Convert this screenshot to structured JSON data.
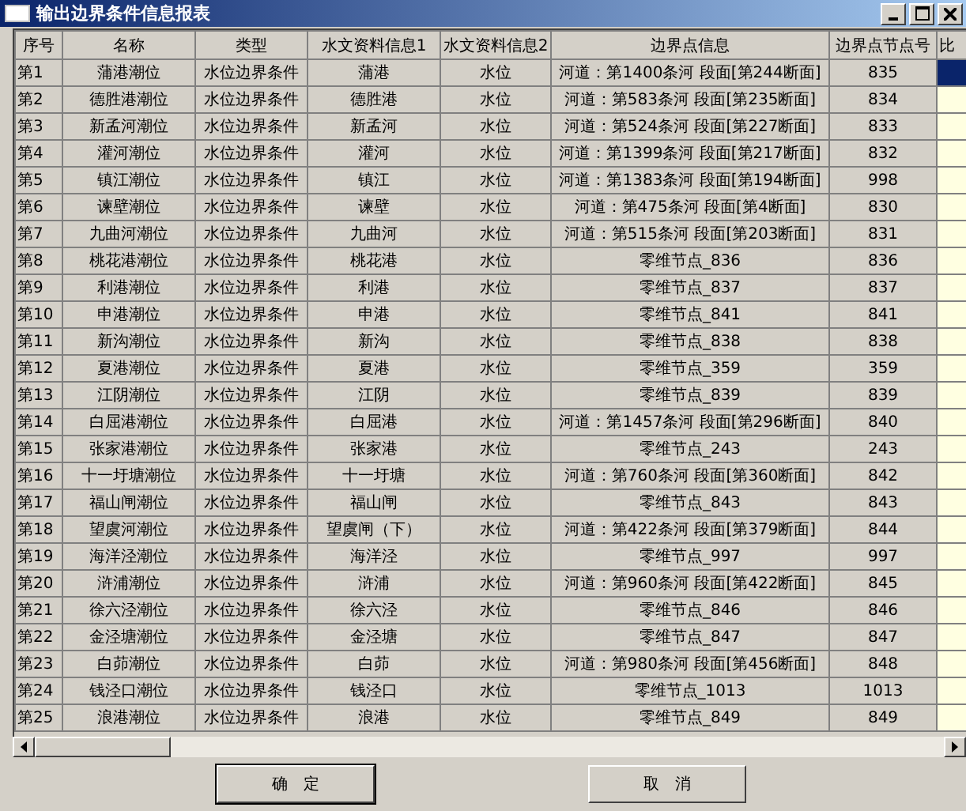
{
  "window": {
    "title": "输出边界条件信息报表"
  },
  "table": {
    "columns": [
      "序号",
      "名称",
      "类型",
      "水文资料信息1",
      "水文资料信息2",
      "边界点信息",
      "边界点节点号",
      "比"
    ],
    "rows": [
      {
        "cells": [
          "第1",
          "蒲港潮位",
          "水位边界条件",
          "蒲港",
          "水位",
          "河道：第1400条河 段面[第244断面]",
          "835"
        ],
        "selected": true
      },
      {
        "cells": [
          "第2",
          "德胜港潮位",
          "水位边界条件",
          "德胜港",
          "水位",
          "河道：第583条河 段面[第235断面]",
          "834"
        ],
        "selected": false
      },
      {
        "cells": [
          "第3",
          "新孟河潮位",
          "水位边界条件",
          "新孟河",
          "水位",
          "河道：第524条河 段面[第227断面]",
          "833"
        ],
        "selected": false
      },
      {
        "cells": [
          "第4",
          "灌河潮位",
          "水位边界条件",
          "灌河",
          "水位",
          "河道：第1399条河 段面[第217断面]",
          "832"
        ],
        "selected": false
      },
      {
        "cells": [
          "第5",
          "镇江潮位",
          "水位边界条件",
          "镇江",
          "水位",
          "河道：第1383条河 段面[第194断面]",
          "998"
        ],
        "selected": false
      },
      {
        "cells": [
          "第6",
          "谏壁潮位",
          "水位边界条件",
          "谏壁",
          "水位",
          "河道：第475条河 段面[第4断面]",
          "830"
        ],
        "selected": false
      },
      {
        "cells": [
          "第7",
          "九曲河潮位",
          "水位边界条件",
          "九曲河",
          "水位",
          "河道：第515条河 段面[第203断面]",
          "831"
        ],
        "selected": false
      },
      {
        "cells": [
          "第8",
          "桃花港潮位",
          "水位边界条件",
          "桃花港",
          "水位",
          "零维节点_836",
          "836"
        ],
        "selected": false
      },
      {
        "cells": [
          "第9",
          "利港潮位",
          "水位边界条件",
          "利港",
          "水位",
          "零维节点_837",
          "837"
        ],
        "selected": false
      },
      {
        "cells": [
          "第10",
          "申港潮位",
          "水位边界条件",
          "申港",
          "水位",
          "零维节点_841",
          "841"
        ],
        "selected": false
      },
      {
        "cells": [
          "第11",
          "新沟潮位",
          "水位边界条件",
          "新沟",
          "水位",
          "零维节点_838",
          "838"
        ],
        "selected": false
      },
      {
        "cells": [
          "第12",
          "夏港潮位",
          "水位边界条件",
          "夏港",
          "水位",
          "零维节点_359",
          "359"
        ],
        "selected": false
      },
      {
        "cells": [
          "第13",
          "江阴潮位",
          "水位边界条件",
          "江阴",
          "水位",
          "零维节点_839",
          "839"
        ],
        "selected": false
      },
      {
        "cells": [
          "第14",
          "白屈港潮位",
          "水位边界条件",
          "白屈港",
          "水位",
          "河道：第1457条河 段面[第296断面]",
          "840"
        ],
        "selected": false
      },
      {
        "cells": [
          "第15",
          "张家港潮位",
          "水位边界条件",
          "张家港",
          "水位",
          "零维节点_243",
          "243"
        ],
        "selected": false
      },
      {
        "cells": [
          "第16",
          "十一圩塘潮位",
          "水位边界条件",
          "十一圩塘",
          "水位",
          "河道：第760条河 段面[第360断面]",
          "842"
        ],
        "selected": false
      },
      {
        "cells": [
          "第17",
          "福山闸潮位",
          "水位边界条件",
          "福山闸",
          "水位",
          "零维节点_843",
          "843"
        ],
        "selected": false
      },
      {
        "cells": [
          "第18",
          "望虞河潮位",
          "水位边界条件",
          "望虞闸（下）",
          "水位",
          "河道：第422条河 段面[第379断面]",
          "844"
        ],
        "selected": false
      },
      {
        "cells": [
          "第19",
          "海洋泾潮位",
          "水位边界条件",
          "海洋泾",
          "水位",
          "零维节点_997",
          "997"
        ],
        "selected": false
      },
      {
        "cells": [
          "第20",
          "浒浦潮位",
          "水位边界条件",
          "浒浦",
          "水位",
          "河道：第960条河 段面[第422断面]",
          "845"
        ],
        "selected": false
      },
      {
        "cells": [
          "第21",
          "徐六泾潮位",
          "水位边界条件",
          "徐六泾",
          "水位",
          "零维节点_846",
          "846"
        ],
        "selected": false
      },
      {
        "cells": [
          "第22",
          "金泾塘潮位",
          "水位边界条件",
          "金泾塘",
          "水位",
          "零维节点_847",
          "847"
        ],
        "selected": false
      },
      {
        "cells": [
          "第23",
          "白茆潮位",
          "水位边界条件",
          "白茆",
          "水位",
          "河道：第980条河 段面[第456断面]",
          "848"
        ],
        "selected": false
      },
      {
        "cells": [
          "第24",
          "钱泾口潮位",
          "水位边界条件",
          "钱泾口",
          "水位",
          "零维节点_1013",
          "1013"
        ],
        "selected": false
      },
      {
        "cells": [
          "第25",
          "浪港潮位",
          "水位边界条件",
          "浪港",
          "水位",
          "零维节点_849",
          "849"
        ],
        "selected": false
      }
    ]
  },
  "buttons": [
    "确　定",
    "取　消"
  ]
}
